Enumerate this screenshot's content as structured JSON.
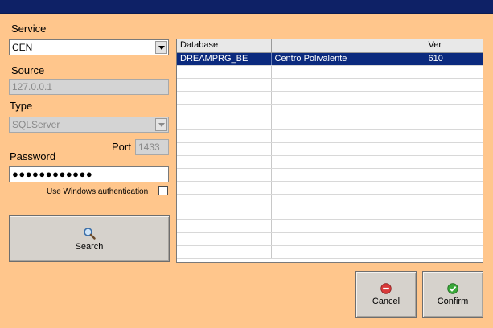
{
  "service": {
    "label": "Service",
    "value": "CEN"
  },
  "source": {
    "label": "Source",
    "value": "127.0.0.1"
  },
  "type": {
    "label": "Type",
    "value": "SQLServer"
  },
  "port": {
    "label": "Port",
    "value": "1433"
  },
  "password": {
    "label": "Password",
    "value": "●●●●●●●●●●●●"
  },
  "windows_auth": {
    "label": "Use Windows authentication",
    "checked": false
  },
  "search_button": {
    "label": "Search",
    "icon": "magnifier-icon"
  },
  "grid": {
    "columns": [
      "Database",
      "",
      "Ver"
    ],
    "rows": [
      [
        "DREAMPRG_BE",
        "Centro Polivalente",
        "610"
      ]
    ],
    "selected_row": 0,
    "total_visible_rows": 16
  },
  "cancel_button": {
    "label": "Cancel",
    "icon": "cancel-icon",
    "color": "#d93a3a"
  },
  "confirm_button": {
    "label": "Confirm",
    "icon": "confirm-icon",
    "color": "#3aa83a"
  },
  "colors": {
    "titlebar": "#0e2166",
    "background": "#ffc68c",
    "selection": "#0b2a7e"
  }
}
